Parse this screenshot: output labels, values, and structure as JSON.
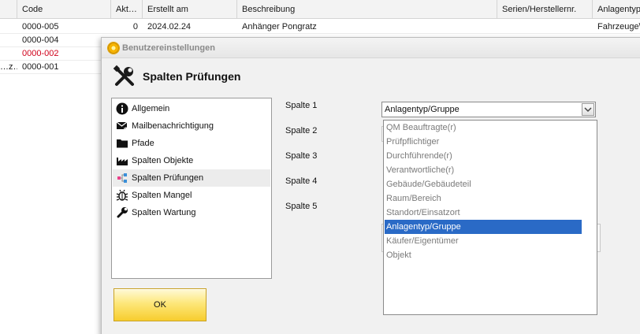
{
  "grid": {
    "headers": [
      "Code",
      "Akt…",
      "Erstellt am",
      "Beschreibung",
      "Serien/Herstellernr.",
      "Anlagentyp\\"
    ],
    "rows": [
      {
        "lead": "",
        "code": "0000-005",
        "akt": "0",
        "erstellt": "2024.02.24",
        "beschreibung": "Anhänger Pongratz",
        "serie": "",
        "typ": "Fahrzeuge\\",
        "code_color": "#1a1a1a"
      },
      {
        "lead": "",
        "code": "0000-004",
        "akt": "",
        "erstellt": "",
        "beschreibung": "",
        "serie": "",
        "typ": "",
        "code_color": "#1a1a1a"
      },
      {
        "lead": "",
        "code": "0000-002",
        "akt": "",
        "erstellt": "",
        "beschreibung": "",
        "serie": "",
        "typ": "",
        "code_color": "#d0021b"
      },
      {
        "lead": "…z…",
        "code": "0000-001",
        "akt": "",
        "erstellt": "",
        "beschreibung": "",
        "serie": "",
        "typ": "",
        "code_color": "#1a1a1a"
      }
    ]
  },
  "dialog": {
    "title": "Benutzereinstellungen",
    "title_icon": "gear-sun-icon",
    "header_icon": "wrench-screwdriver-icon",
    "header_title": "Spalten Prüfungen",
    "sidebar": [
      {
        "label": "Allgemein",
        "icon": "info-icon"
      },
      {
        "label": "Mailbenachrichtigung",
        "icon": "mail-forward-icon"
      },
      {
        "label": "Pfade",
        "icon": "folder-icon"
      },
      {
        "label": "Spalten Objekte",
        "icon": "factory-icon"
      },
      {
        "label": "Spalten Prüfungen",
        "icon": "hierarchy-icon",
        "active": true
      },
      {
        "label": "Spalten Mangel",
        "icon": "bug-icon"
      },
      {
        "label": "Spalten Wartung",
        "icon": "wrench-icon"
      }
    ],
    "column_labels": [
      "Spalte 1",
      "Spalte 2",
      "Spalte 3",
      "Spalte 4",
      "Spalte 5"
    ],
    "combo_value": "Anlagentyp/Gruppe",
    "dropdown_options": [
      "QM Beauftragte(r)",
      "Prüfpflichtiger",
      "Durchführende(r)",
      "Verantwortliche(r)",
      "Gebäude/Gebäudeteil",
      "Raum/Bereich",
      "Standort/Einsatzort",
      "Anlagentyp/Gruppe",
      "Käufer/Eigentümer",
      "Objekt"
    ],
    "selected_option": "Anlagentyp/Gruppe",
    "ok_label": "OK",
    "accent_color": "#2a6ac6",
    "ok_color": "#f7cd2e"
  }
}
